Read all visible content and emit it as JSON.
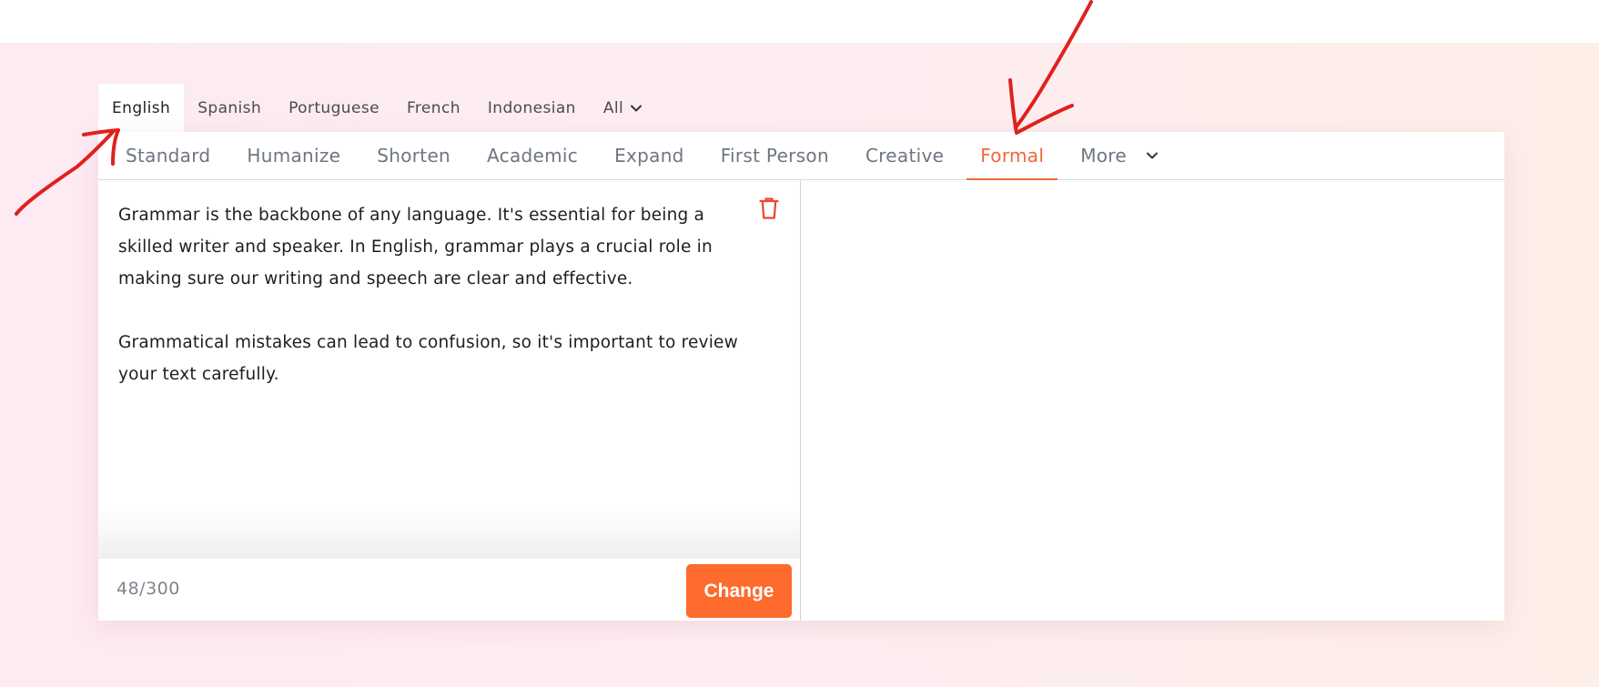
{
  "languages": {
    "tabs": [
      {
        "label": "English",
        "active": true
      },
      {
        "label": "Spanish",
        "active": false
      },
      {
        "label": "Portuguese",
        "active": false
      },
      {
        "label": "French",
        "active": false
      },
      {
        "label": "Indonesian",
        "active": false
      },
      {
        "label": "All",
        "active": false
      }
    ]
  },
  "modes": {
    "tabs": [
      {
        "label": "Standard",
        "active": false
      },
      {
        "label": "Humanize",
        "active": false
      },
      {
        "label": "Shorten",
        "active": false
      },
      {
        "label": "Academic",
        "active": false
      },
      {
        "label": "Expand",
        "active": false
      },
      {
        "label": "First Person",
        "active": false
      },
      {
        "label": "Creative",
        "active": false
      },
      {
        "label": "Formal",
        "active": true
      },
      {
        "label": "More",
        "active": false
      }
    ]
  },
  "editor": {
    "paragraph1": "Grammar is the backbone of any language. It's essential for being a skilled writer and speaker. In English, grammar plays a crucial role in making sure our writing and speech are clear and effective.",
    "paragraph2": "Grammatical mistakes can lead to confusion, so it's important to review your text carefully.",
    "word_count": "48/300",
    "submit_label": "Change"
  },
  "colors": {
    "accent": "#f0673a",
    "button": "#fe6b2d",
    "annotation": "#e0201e"
  },
  "icons": {
    "clear": "trash-icon",
    "dropdown": "chevron-down-icon"
  }
}
